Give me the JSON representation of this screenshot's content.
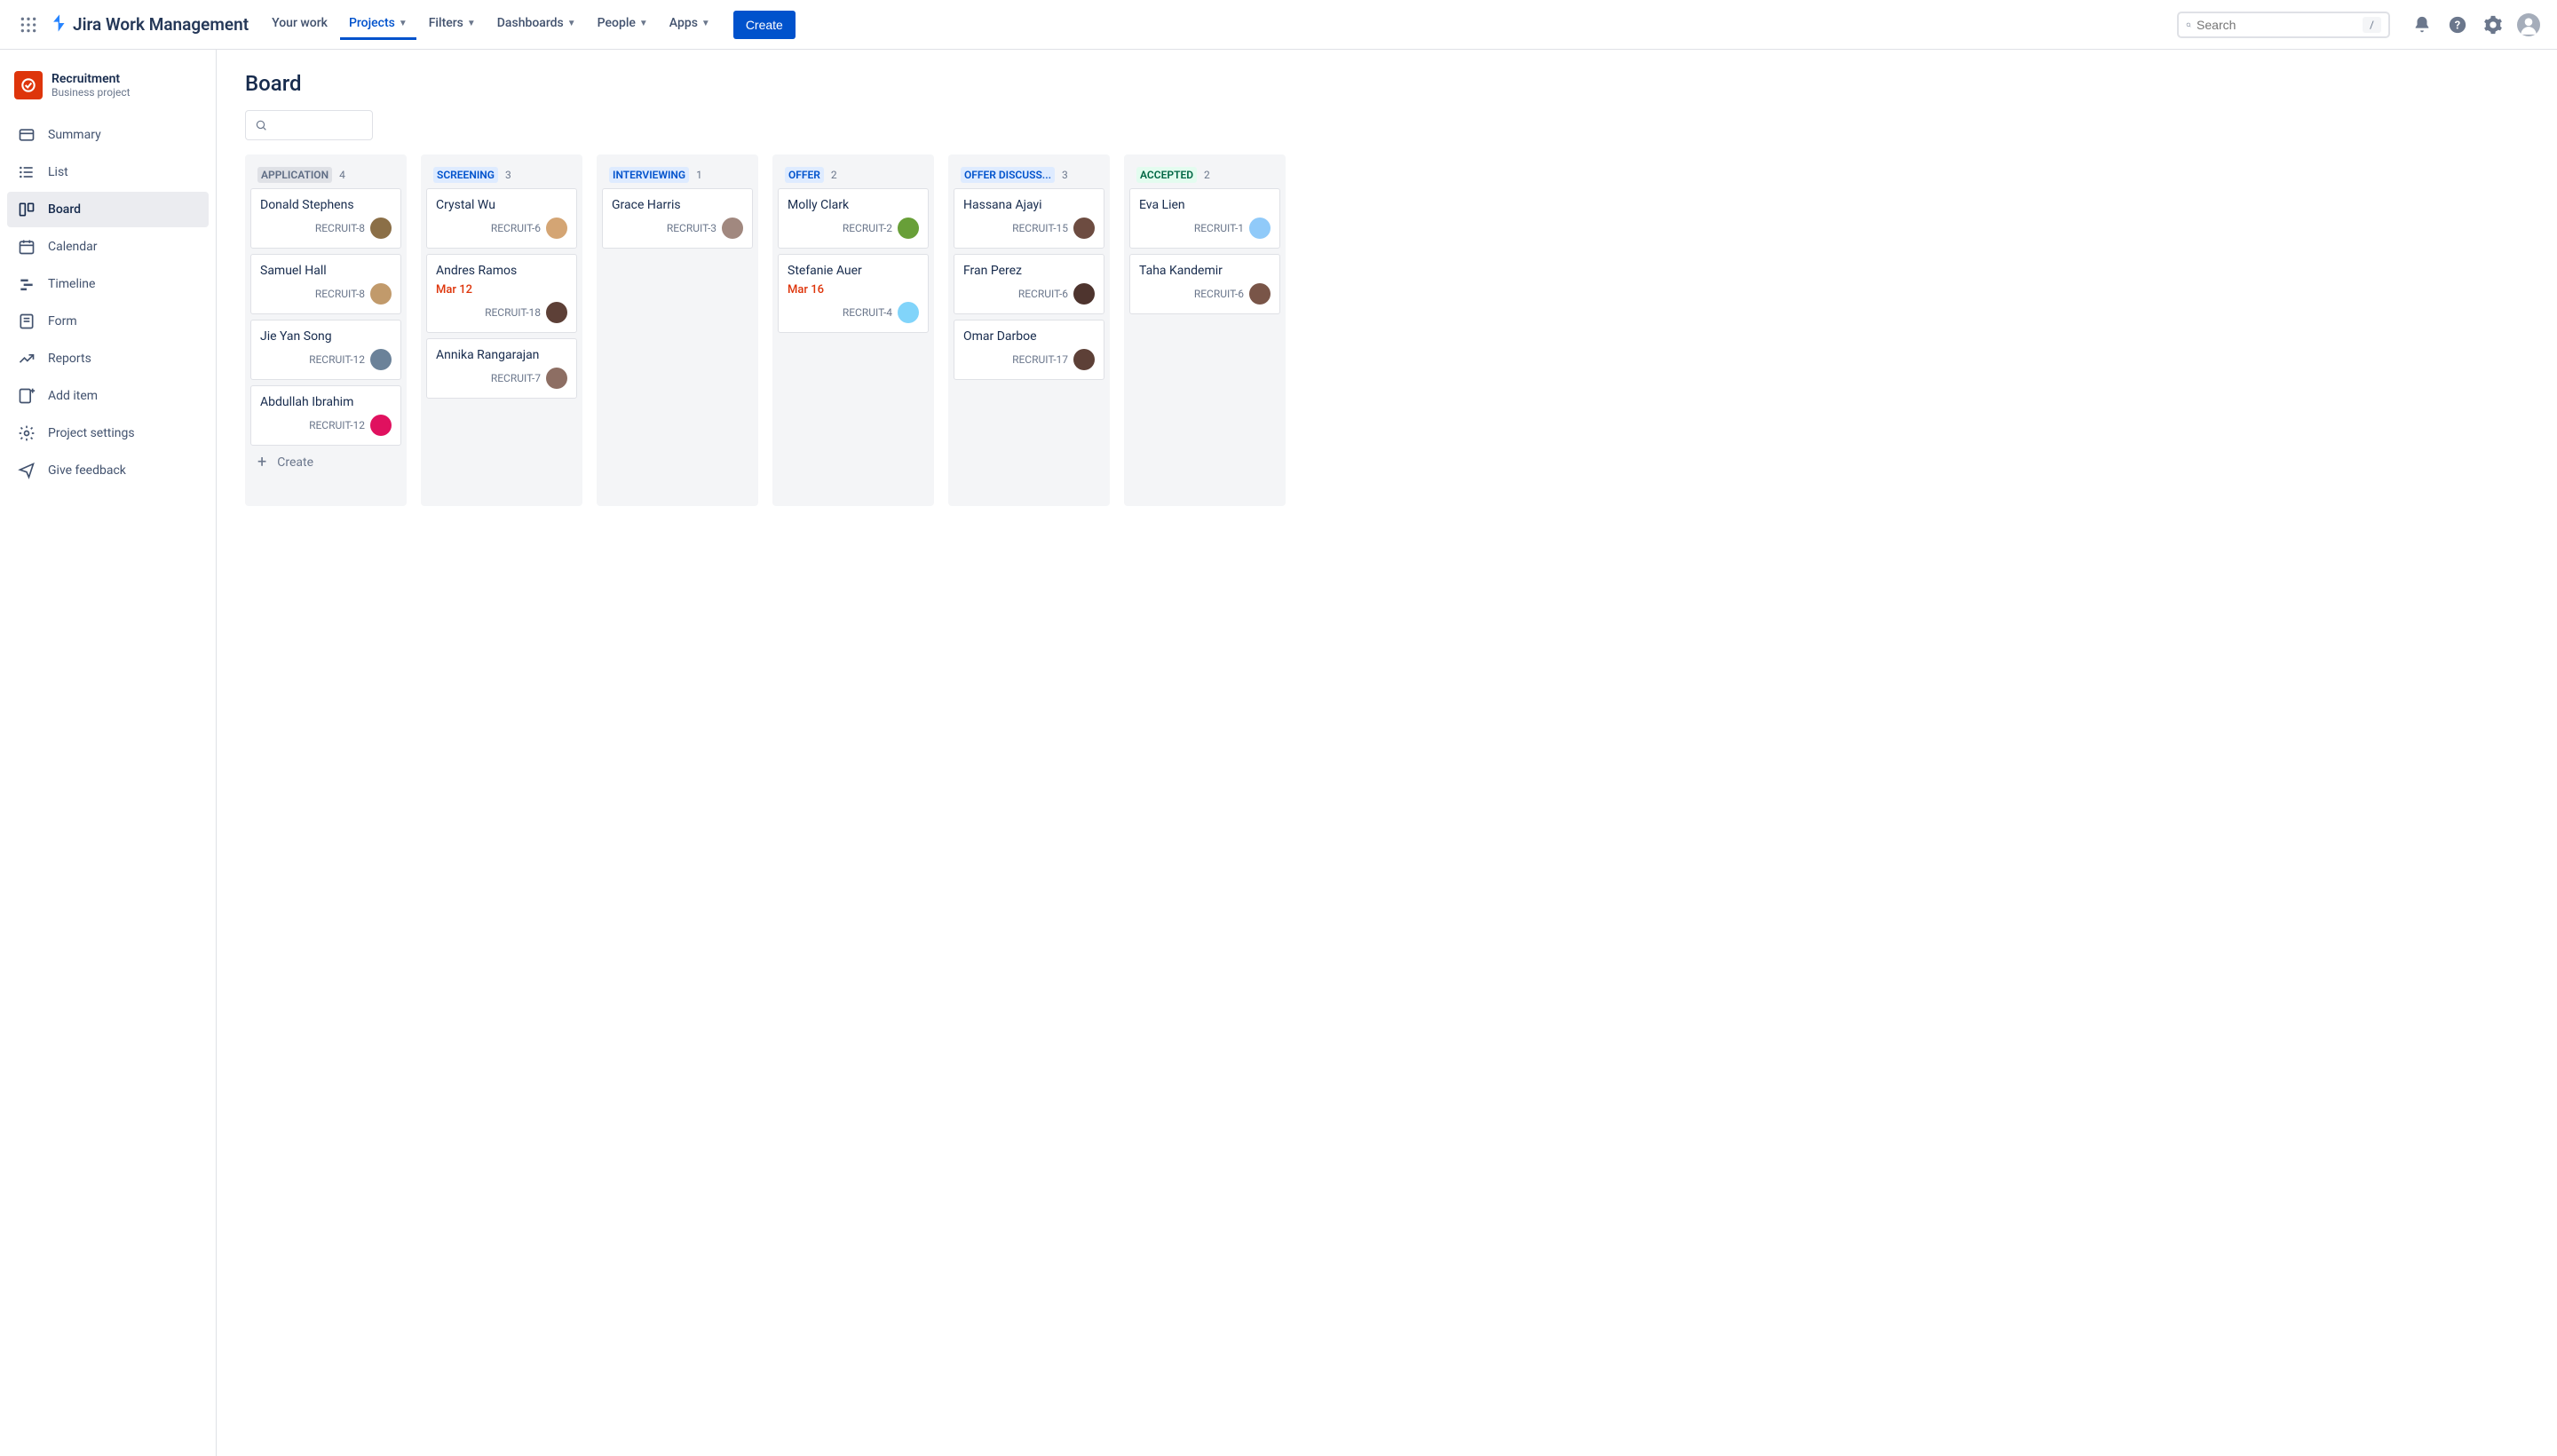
{
  "topnav": {
    "app_name": "Jira Work Management",
    "items": [
      {
        "label": "Your work",
        "dropdown": false,
        "active": false
      },
      {
        "label": "Projects",
        "dropdown": true,
        "active": true
      },
      {
        "label": "Filters",
        "dropdown": true,
        "active": false
      },
      {
        "label": "Dashboards",
        "dropdown": true,
        "active": false
      },
      {
        "label": "People",
        "dropdown": true,
        "active": false
      },
      {
        "label": "Apps",
        "dropdown": true,
        "active": false
      }
    ],
    "create_label": "Create",
    "search_placeholder": "Search",
    "kbd_hint": "/"
  },
  "sidebar": {
    "project_title": "Recruitment",
    "project_subtitle": "Business project",
    "items": [
      {
        "label": "Summary",
        "icon": "summary",
        "active": false
      },
      {
        "label": "List",
        "icon": "list",
        "active": false
      },
      {
        "label": "Board",
        "icon": "board",
        "active": true
      },
      {
        "label": "Calendar",
        "icon": "calendar",
        "active": false
      },
      {
        "label": "Timeline",
        "icon": "timeline",
        "active": false
      },
      {
        "label": "Form",
        "icon": "form",
        "active": false
      },
      {
        "label": "Reports",
        "icon": "reports",
        "active": false
      },
      {
        "label": "Add item",
        "icon": "add-item",
        "active": false
      },
      {
        "label": "Project settings",
        "icon": "settings",
        "active": false
      },
      {
        "label": "Give feedback",
        "icon": "feedback",
        "active": false
      }
    ]
  },
  "board": {
    "title": "Board",
    "create_card_label": "Create",
    "columns": [
      {
        "name": "APPLICATION",
        "count": 4,
        "pill_bg": "#DFE1E6",
        "pill_fg": "#5E6C84",
        "show_create": true,
        "cards": [
          {
            "title": "Donald Stephens",
            "key": "RECRUIT-8",
            "avatar": "#8B6F47"
          },
          {
            "title": "Samuel Hall",
            "key": "RECRUIT-8",
            "avatar": "#C19A6B"
          },
          {
            "title": "Jie Yan Song",
            "key": "RECRUIT-12",
            "avatar": "#6B8299"
          },
          {
            "title": "Abdullah Ibrahim",
            "key": "RECRUIT-12",
            "avatar": "#E0115F"
          }
        ]
      },
      {
        "name": "SCREENING",
        "count": 3,
        "pill_bg": "#DEEBFF",
        "pill_fg": "#0052CC",
        "cards": [
          {
            "title": "Crystal Wu",
            "key": "RECRUIT-6",
            "avatar": "#D4A574"
          },
          {
            "title": "Andres Ramos",
            "date": "Mar 12",
            "key": "RECRUIT-18",
            "avatar": "#5D4037"
          },
          {
            "title": "Annika Rangarajan",
            "key": "RECRUIT-7",
            "avatar": "#8D6E63"
          }
        ]
      },
      {
        "name": "INTERVIEWING",
        "count": 1,
        "pill_bg": "#DEEBFF",
        "pill_fg": "#0052CC",
        "cards": [
          {
            "title": "Grace Harris",
            "key": "RECRUIT-3",
            "avatar": "#A1887F"
          }
        ]
      },
      {
        "name": "OFFER",
        "count": 2,
        "pill_bg": "#DEEBFF",
        "pill_fg": "#0052CC",
        "cards": [
          {
            "title": "Molly Clark",
            "key": "RECRUIT-2",
            "avatar": "#689F38"
          },
          {
            "title": "Stefanie Auer",
            "date": "Mar 16",
            "key": "RECRUIT-4",
            "avatar": "#81D4FA"
          }
        ]
      },
      {
        "name": "OFFER DISCUSS...",
        "count": 3,
        "pill_bg": "#DEEBFF",
        "pill_fg": "#0052CC",
        "cards": [
          {
            "title": "Hassana Ajayi",
            "key": "RECRUIT-15",
            "avatar": "#6D4C41"
          },
          {
            "title": "Fran Perez",
            "key": "RECRUIT-6",
            "avatar": "#4E342E"
          },
          {
            "title": "Omar Darboe",
            "key": "RECRUIT-17",
            "avatar": "#5D4037"
          }
        ]
      },
      {
        "name": "ACCEPTED",
        "count": 2,
        "pill_bg": "#E3FCEF",
        "pill_fg": "#006644",
        "cards": [
          {
            "title": "Eva Lien",
            "key": "RECRUIT-1",
            "avatar": "#90CAF9"
          },
          {
            "title": "Taha Kandemir",
            "key": "RECRUIT-6",
            "avatar": "#795548"
          }
        ]
      }
    ]
  }
}
